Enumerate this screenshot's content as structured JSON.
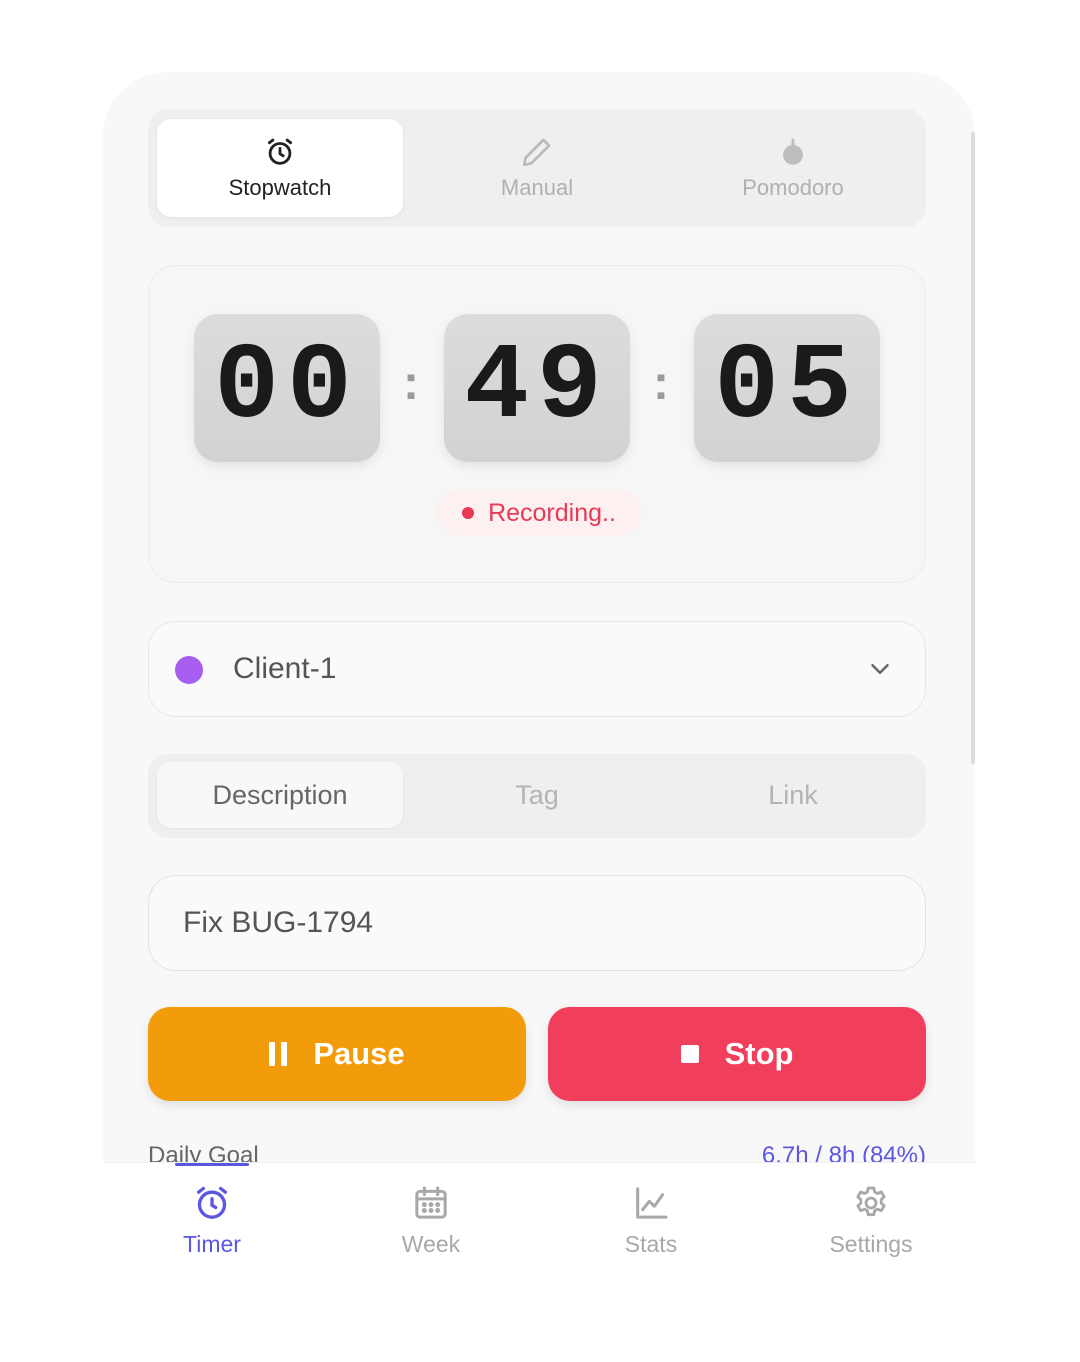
{
  "mode_tabs": [
    {
      "label": "Stopwatch",
      "icon": "alarm-clock-icon",
      "active": true
    },
    {
      "label": "Manual",
      "icon": "pencil-icon",
      "active": false
    },
    {
      "label": "Pomodoro",
      "icon": "tomato-icon",
      "active": false
    }
  ],
  "timer": {
    "hours": "00",
    "minutes": "49",
    "seconds": "05",
    "separator": ":",
    "status": "Recording.."
  },
  "client": {
    "name": "Client-1",
    "color": "#a55ef0"
  },
  "field_tabs": [
    {
      "label": "Description",
      "active": true
    },
    {
      "label": "Tag",
      "active": false
    },
    {
      "label": "Link",
      "active": false
    }
  ],
  "description": {
    "value": "Fix BUG-1794"
  },
  "actions": {
    "pause_label": "Pause",
    "stop_label": "Stop"
  },
  "daily_goal": {
    "label": "Daily Goal",
    "value": "6.7h / 8h (84%)"
  },
  "bottom_nav": [
    {
      "label": "Timer",
      "icon": "alarm-clock-icon",
      "active": true
    },
    {
      "label": "Week",
      "icon": "calendar-icon",
      "active": false
    },
    {
      "label": "Stats",
      "icon": "line-chart-icon",
      "active": false
    },
    {
      "label": "Settings",
      "icon": "gear-icon",
      "active": false
    }
  ],
  "colors": {
    "accent": "#5b57e0",
    "pause": "#f39c0b",
    "stop": "#f23e5d",
    "recording": "#e73a55"
  }
}
